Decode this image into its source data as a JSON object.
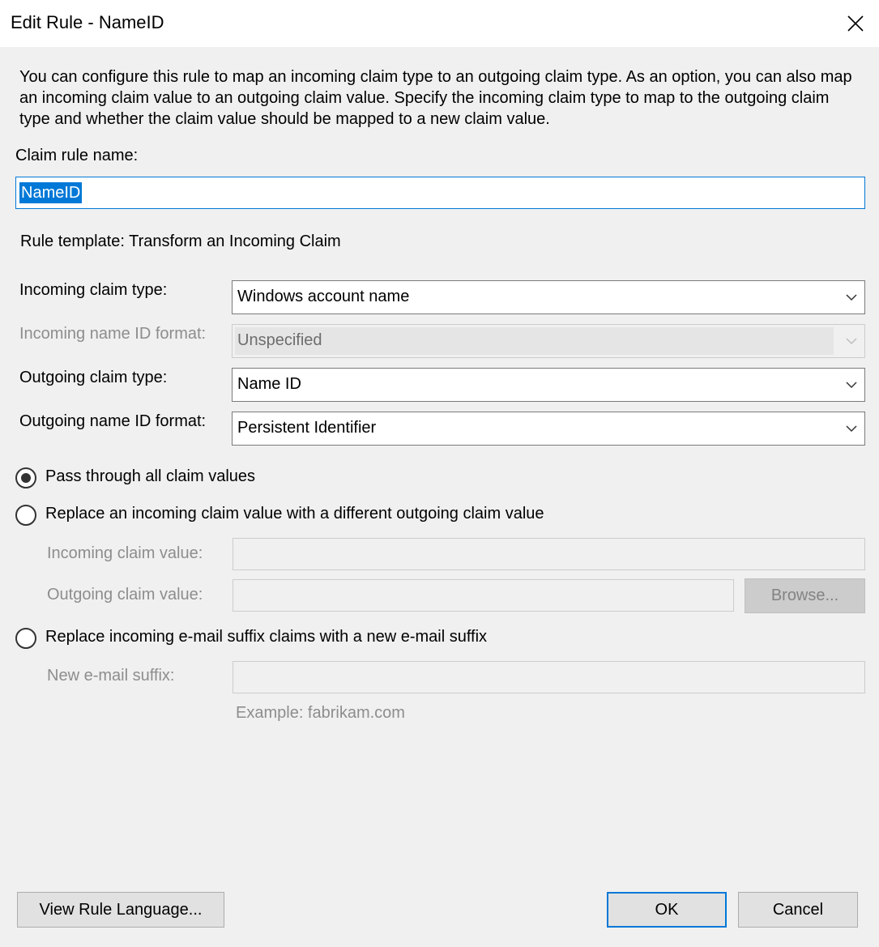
{
  "window": {
    "title": "Edit Rule - NameID"
  },
  "description": "You can configure this rule to map an incoming claim type to an outgoing claim type. As an option, you can also map an incoming claim value to an outgoing claim value. Specify the incoming claim type to map to the outgoing claim type and whether the claim value should be mapped to a new claim value.",
  "claim_rule_name": {
    "label": "Claim rule name:",
    "value": "NameID"
  },
  "rule_template": "Rule template: Transform an Incoming Claim",
  "fields": {
    "incoming_claim_type": {
      "label": "Incoming claim type:",
      "value": "Windows account name"
    },
    "incoming_name_id_format": {
      "label": "Incoming name ID format:",
      "value": "Unspecified",
      "enabled": false
    },
    "outgoing_claim_type": {
      "label": "Outgoing claim type:",
      "value": "Name ID"
    },
    "outgoing_name_id_format": {
      "label": "Outgoing name ID format:",
      "value": "Persistent Identifier"
    }
  },
  "options": [
    {
      "label": "Pass through all claim values",
      "selected": true
    },
    {
      "label": "Replace an incoming claim value with a different outgoing claim value",
      "selected": false
    },
    {
      "label": "Replace incoming e-mail suffix claims with a new e-mail suffix",
      "selected": false
    }
  ],
  "replace_value": {
    "incoming_label": "Incoming claim value:",
    "incoming_value": "",
    "outgoing_label": "Outgoing claim value:",
    "outgoing_value": "",
    "browse_label": "Browse..."
  },
  "email_suffix": {
    "label": "New e-mail suffix:",
    "value": "",
    "example": "Example: fabrikam.com"
  },
  "buttons": {
    "view_rule_language": "View Rule Language...",
    "ok": "OK",
    "cancel": "Cancel"
  }
}
